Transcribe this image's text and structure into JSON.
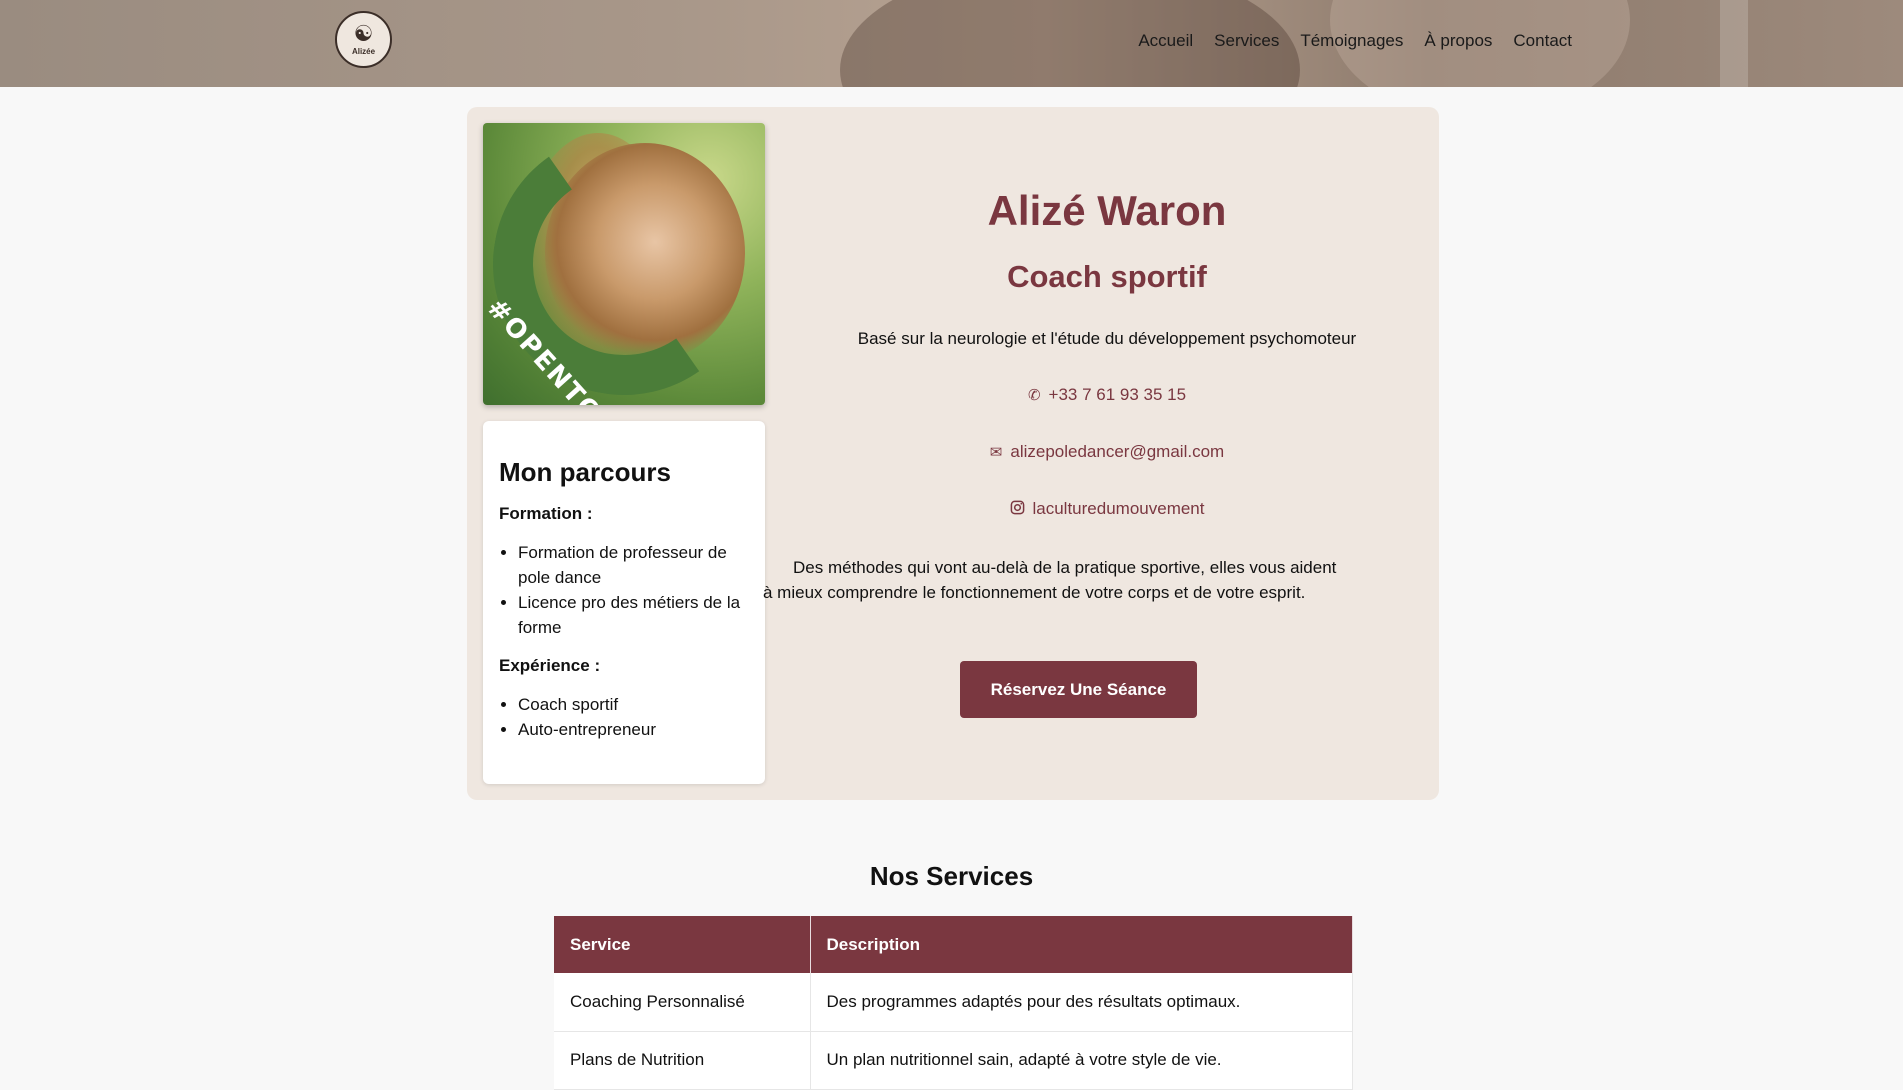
{
  "header": {
    "logo_text": "Alizée",
    "nav": [
      "Accueil",
      "Services",
      "Témoignages",
      "À propos",
      "Contact"
    ]
  },
  "photo": {
    "badge": "#OPENTOWORK"
  },
  "parcours": {
    "title": "Mon parcours",
    "formation_label": "Formation :",
    "formation_items": [
      "Formation de professeur de pole dance",
      "Licence pro des métiers de la forme"
    ],
    "experience_label": "Expérience :",
    "experience_items": [
      "Coach sportif",
      "Auto-entrepreneur"
    ]
  },
  "profile": {
    "name": "Alizé Waron",
    "role": "Coach sportif",
    "tagline": "Basé sur la neurologie et l'étude du développement psychomoteur",
    "phone": "+33 7 61 93 35 15",
    "email": "alizepoledancer@gmail.com",
    "instagram": "laculturedumouvement",
    "description": "Des méthodes qui vont au-delà de la pratique sportive, elles vous aident à mieux comprendre le fonctionnement de votre corps et de votre esprit.",
    "cta": "Réservez Une Séance"
  },
  "services": {
    "title": "Nos Services",
    "headers": [
      "Service",
      "Description"
    ],
    "rows": [
      [
        "Coaching Personnalisé",
        "Des programmes adaptés pour des résultats optimaux."
      ],
      [
        "Plans de Nutrition",
        "Un plan nutritionnel sain, adapté à votre style de vie."
      ]
    ]
  },
  "colors": {
    "accent": "#7a3740",
    "card_bg": "#efe7e0"
  },
  "icons": {
    "phone": "phone-icon",
    "email": "envelope-icon",
    "instagram": "instagram-icon"
  }
}
